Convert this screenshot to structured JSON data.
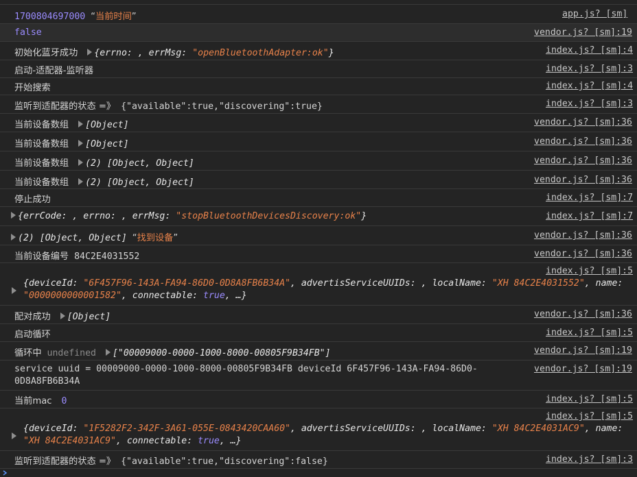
{
  "console": {
    "rows": [
      {
        "msg": "1700804697000 “当前时间”",
        "src": "app.js? [sm]"
      },
      {
        "msg": "false",
        "src": "vendor.js? [sm]:19"
      },
      {
        "msg": "初始化蓝牙成功 ▸{errno: , errMsg: \"openBluetoothAdapter:ok\"}",
        "src": "index.js? [sm]:4"
      },
      {
        "msg": "启动-适配器-监听器",
        "src": "index.js? [sm]:3"
      },
      {
        "msg": "开始搜索",
        "src": "index.js? [sm]:4"
      },
      {
        "msg": "监听到适配器的状态 =》 {\"available\":true,\"discovering\":true}",
        "src": "index.js? [sm]:3"
      },
      {
        "msg": "当前设备数组 ▸[Object]",
        "src": "vendor.js? [sm]:36"
      },
      {
        "msg": "当前设备数组 ▸[Object]",
        "src": "vendor.js? [sm]:36"
      },
      {
        "msg": "当前设备数组 ▸(2) [Object, Object]",
        "src": "vendor.js? [sm]:36"
      },
      {
        "msg": "当前设备数组 ▸(2) [Object, Object]",
        "src": "vendor.js? [sm]:36"
      },
      {
        "msg": "停止成功",
        "src": "index.js? [sm]:7"
      },
      {
        "msg": "▸{errCode: , errno: , errMsg: \"stopBluetoothDevicesDiscovery:ok\"}",
        "src": "index.js? [sm]:7"
      },
      {
        "msg": "▸(2) [Object, Object] “找到设备”",
        "src": "vendor.js? [sm]:36"
      },
      {
        "msg": "当前设备编号 84C2E4031552",
        "src": "vendor.js? [sm]:36"
      },
      {
        "msg": "▸{deviceId: \"6F457F96-143A-FA94-86D0-0D8A8FB6B34A\", advertisServiceUUIDs: , localName: \"XH 84C2E4031552\", name: \"0000000000001582\", connectable: true, …}",
        "src": "index.js? [sm]:5"
      },
      {
        "msg": "配对成功 ▸[Object]",
        "src": "vendor.js? [sm]:36"
      },
      {
        "msg": "启动循环",
        "src": "index.js? [sm]:5"
      },
      {
        "msg": "循环中 undefined ▸[\"00009000-0000-1000-8000-00805F9B34FB\"]",
        "src": "vendor.js? [sm]:19"
      },
      {
        "msg": "service uuid = 00009000-0000-1000-8000-00805F9B34FB deviceId  6F457F96-143A-FA94-86D0-0D8A8FB6B34A",
        "src": "vendor.js? [sm]:19"
      },
      {
        "msg": "当前mac  0",
        "src": "index.js? [sm]:5"
      },
      {
        "msg": "▸{deviceId: \"1F5282F2-342F-3A61-055E-0843420CAA60\", advertisServiceUUIDs: , localName: \"XH 84C2E4031AC9\", name: \"XH 84C2E4031AC9\", connectable: true, …}",
        "src": "index.js? [sm]:5"
      },
      {
        "msg": "监听到适配器的状态 =》 {\"available\":true,\"discovering\":false}",
        "src": "index.js? [sm]:3"
      }
    ],
    "prompt_icon": "chevron-right-icon",
    "colors": {
      "background": "#242424",
      "string": "#e8824a",
      "keyword": "#9b8cff",
      "text": "#d5d5d5",
      "divider": "#3a3a3a"
    }
  }
}
